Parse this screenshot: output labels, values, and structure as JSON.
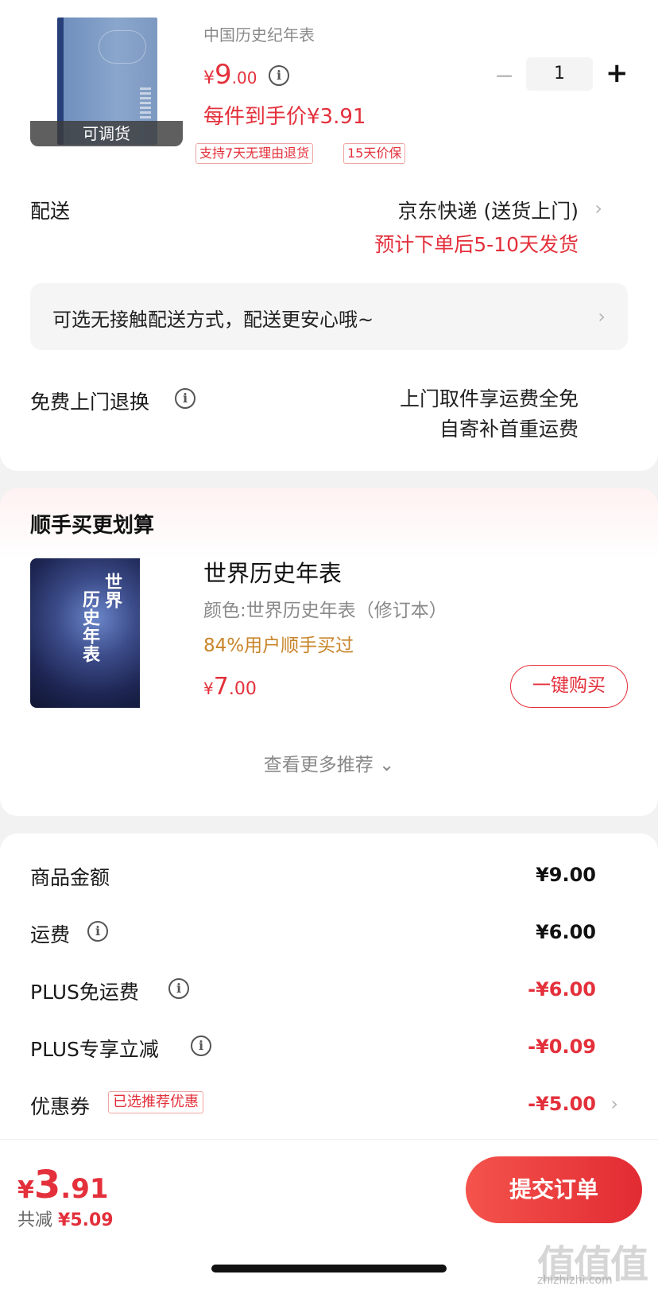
{
  "product": {
    "stock_badge": "可调货",
    "name": "中国历史纪年表",
    "price_currency": "¥",
    "price_int": "9",
    "price_dec": ".00",
    "unit_price": "每件到手价¥3.91",
    "tags": [
      "支持7天无理由退货",
      "15天价保"
    ],
    "quantity": "1",
    "minus": "−",
    "plus": "+"
  },
  "delivery": {
    "label": "配送",
    "method": "京东快递 (送货上门)",
    "estimate": "预计下单后5-10天发货",
    "no_contact": "可选无接触配送方式，配送更安心哦~"
  },
  "return_service": {
    "label": "免费上门退换",
    "line1": "上门取件享运费全免",
    "line2": "自寄补首重运费"
  },
  "recommend": {
    "title": "顺手买更划算",
    "item_name": "世界历史年表",
    "cover_title1": "世界",
    "cover_title2": "历史年表",
    "color": "颜色:世界历史年表（修订本）",
    "pct": "84%用户顺手买过",
    "price_currency": "¥",
    "price_int": "7",
    "price_dec": ".00",
    "buy_label": "一键购买",
    "more": "查看更多推荐 ⌄"
  },
  "summary": {
    "goods_label": "商品金额",
    "goods_value": "¥9.00",
    "shipping_label": "运费",
    "shipping_value": "¥6.00",
    "plus_free_label": "PLUS免运费",
    "plus_free_value": "-¥6.00",
    "plus_cut_label": "PLUS专享立减",
    "plus_cut_value": "-¥0.09",
    "coupon_label": "优惠券",
    "coupon_tag": "已选推荐优惠",
    "coupon_value": "-¥5.00"
  },
  "footer": {
    "total_currency": "¥",
    "total_int": "3",
    "total_dec": ".91",
    "saved_label": "共减",
    "saved_amount": "¥5.09",
    "submit_label": "提交订单"
  },
  "watermark": {
    "mark": "值值值",
    "url": "zhizhizhi.com"
  },
  "icons": {
    "info": "info-circle-icon",
    "chevron": "chevron-right-icon"
  },
  "colors": {
    "accent": "#e3303b",
    "orange": "#c8852a"
  }
}
